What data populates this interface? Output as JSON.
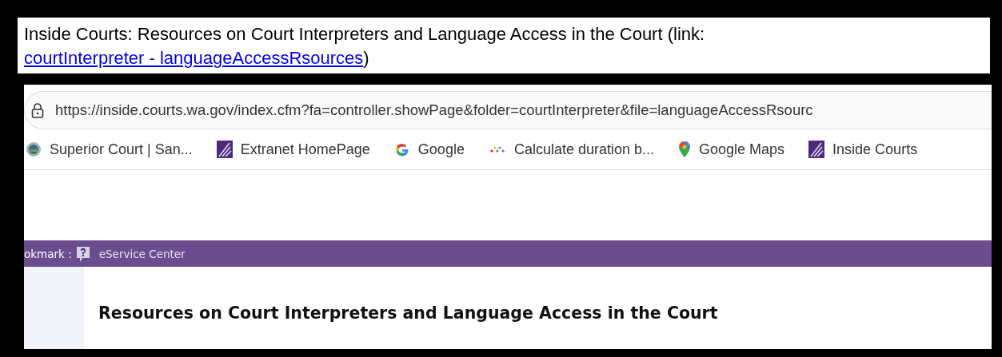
{
  "caption": {
    "text": "Inside Courts: Resources on Court Interpreters and Language Access in the Court (link: ",
    "link": "courtInterpreter - languageAccessRsources",
    "closing": ")"
  },
  "browser": {
    "url": "https://inside.courts.wa.gov/index.cfm?fa=controller.showPage&folder=courtInterpreter&file=languageAccessRsourc",
    "bookmarks": [
      {
        "label": "Superior Court | San...",
        "kind": "seal"
      },
      {
        "label": "Extranet HomePage",
        "kind": "courts"
      },
      {
        "label": "Google",
        "kind": "google"
      },
      {
        "label": "Calculate duration b...",
        "kind": "dots"
      },
      {
        "label": "Google Maps",
        "kind": "maps"
      },
      {
        "label": "Inside Courts",
        "kind": "courts"
      }
    ]
  },
  "page": {
    "nav": [
      {
        "label": "okmark :",
        "kind": "text"
      },
      {
        "label": "eService Center",
        "kind": "help"
      }
    ],
    "heading": "Resources on Court Interpreters and Language Access in the Court"
  }
}
